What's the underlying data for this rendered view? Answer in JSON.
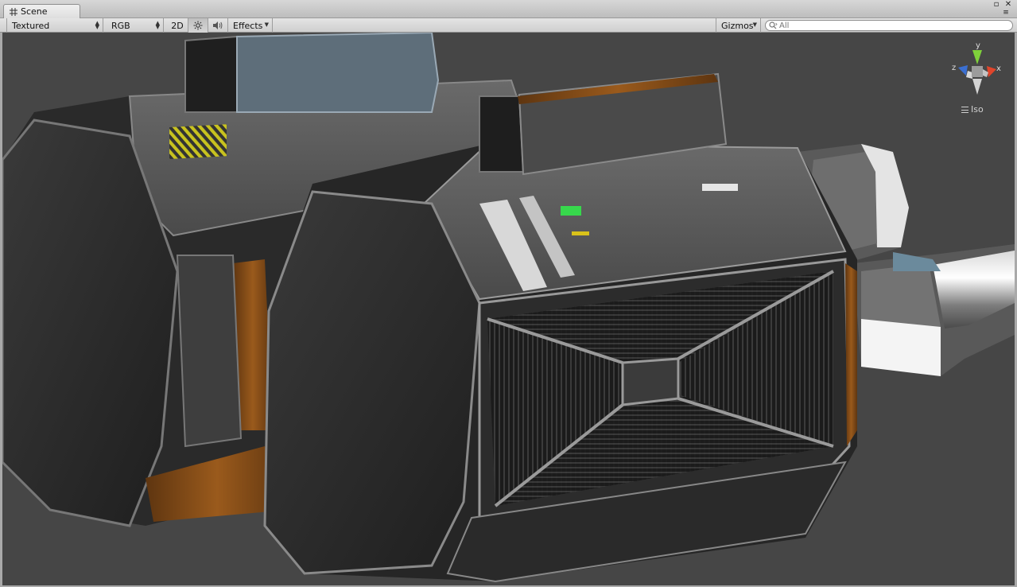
{
  "window": {
    "tab_label": "Scene",
    "tab_icon": "hash-grid-icon",
    "maximize_glyph": "▫",
    "close_glyph": "✕",
    "menu_glyph": "≡"
  },
  "toolbar": {
    "draw_mode": "Textured",
    "render_mode": "RGB",
    "toggle_2d": "2D",
    "lighting_icon": "sun-icon",
    "audio_icon": "speaker-icon",
    "effects_label": "Effects",
    "gizmos_label": "Gizmos"
  },
  "search": {
    "placeholder": "All",
    "icon": "search-icon"
  },
  "scene_gizmo": {
    "axis_y": "y",
    "axis_x": "x",
    "axis_z": "z",
    "projection_label": "Iso",
    "colors": {
      "x": "#e0452b",
      "y": "#7fd13b",
      "z": "#3b6fd1"
    }
  },
  "colors": {
    "viewport_background": "#464646",
    "toolbar_background": "#dadada",
    "metal_dark": "#2b2b2b",
    "metal_mid": "#5c5c5c",
    "trim_orange": "#8a4f17",
    "indicator_green": "#37d84c",
    "indicator_yellow": "#d9c21a"
  }
}
